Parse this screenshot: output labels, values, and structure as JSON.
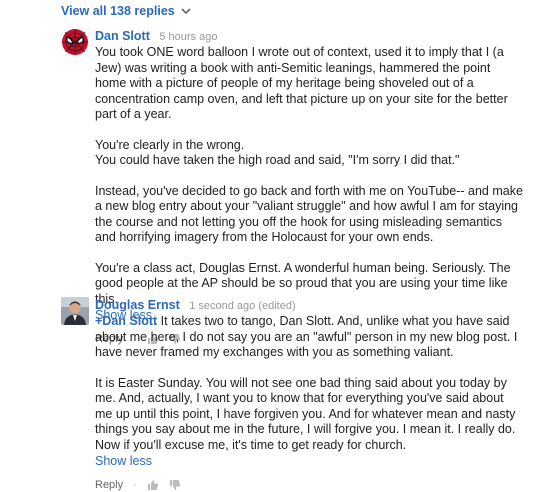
{
  "view_all": {
    "label": "View all 138 replies"
  },
  "comments": [
    {
      "author": "Dan Slott",
      "time": "5 hours ago",
      "paragraphs": [
        "You took ONE word balloon I wrote out of context, used it to imply that I (a Jew) was writing a book with anti-Semitic leanings, hammered the point home with a picture of people of my heritage being shoveled out of a concentration camp oven, and left that picture up on your site for the better part of a year.",
        "You're clearly in the wrong.\nYou could have taken the high road and said, \"I'm sorry I did that.\"",
        "Instead, you've decided to go back and forth with me on YouTube-- and make a new blog entry about your \"valiant struggle\" and how awful I am for staying the course and not letting you off the hook for using misleading semantics and horrifying imagery from the Holocaust for your own ends.",
        "You're a class act, Douglas Ernst. A wonderful human being. Seriously. The good people at the AP should be so proud that you are using your time like this."
      ],
      "show_less": "Show less",
      "reply": "Reply",
      "avatar_icon": "spiderman-avatar"
    },
    {
      "author": "Douglas Ernst",
      "time": "1 second ago (edited)",
      "mention": "+Dan Slott",
      "paragraphs": [
        " It takes two to tango, Dan Slott. And, unlike what you have said about me here, I do not say you are an \"awful\" person in my new blog post. I have never framed my exchanges with you as something valiant.",
        "It is Easter Sunday. You will not see one bad thing said about you today by me. And, actually, I want you to know that for everything you've said about me up until this point, I have forgiven you. And for whatever mean and nasty things you say about me in the future, I will forgive you. I mean it. I really do. Now if you'll excuse me, it's time to get ready for church."
      ],
      "show_less": "Show less",
      "reply": "Reply",
      "avatar_icon": "person-avatar"
    }
  ],
  "colors": {
    "link": "#2a6ab8",
    "muted": "#999999"
  }
}
